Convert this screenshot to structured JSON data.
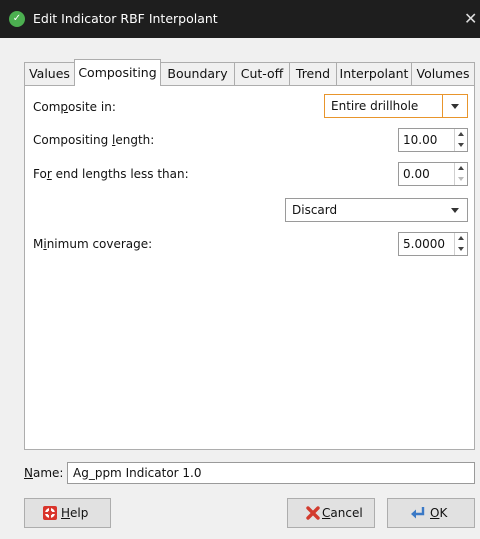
{
  "window": {
    "title": "Edit Indicator RBF Interpolant",
    "close_glyph": "✕"
  },
  "tabs": [
    {
      "label": "Values"
    },
    {
      "label": "Compositing"
    },
    {
      "label": "Boundary"
    },
    {
      "label": "Cut-off"
    },
    {
      "label": "Trend"
    },
    {
      "label": "Interpolant"
    },
    {
      "label": "Volumes"
    }
  ],
  "active_tab": "Compositing",
  "form": {
    "composite_in": {
      "label_pre": "Com",
      "label_u": "p",
      "label_post": "osite in:",
      "value": "Entire drillhole"
    },
    "compositing_length": {
      "label_pre": "Compositing ",
      "label_u": "l",
      "label_post": "ength:",
      "value": "10.00"
    },
    "end_lengths": {
      "label_pre": "Fo",
      "label_u": "r",
      "label_post": " end lengths less than:",
      "value": "0.00"
    },
    "end_action": {
      "value": "Discard"
    },
    "minimum_coverage": {
      "label_pre": "M",
      "label_u": "i",
      "label_post": "nimum coverage:",
      "value": "5.0000"
    }
  },
  "name": {
    "label_u": "N",
    "label_post": "ame:",
    "value": "Ag_ppm Indicator 1.0"
  },
  "buttons": {
    "help": {
      "u": "H",
      "rest": "elp"
    },
    "cancel": {
      "u": "C",
      "rest": "ancel"
    },
    "ok": {
      "u": "O",
      "rest": "K"
    }
  },
  "colors": {
    "titlebar": "#1e1e1e",
    "focus": "#e8952c",
    "app_icon": "#4caf50"
  },
  "icons": {
    "app": "leapfrog-icon",
    "help": "lifebuoy-icon",
    "cancel": "red-x-icon",
    "ok": "return-arrow-icon"
  }
}
